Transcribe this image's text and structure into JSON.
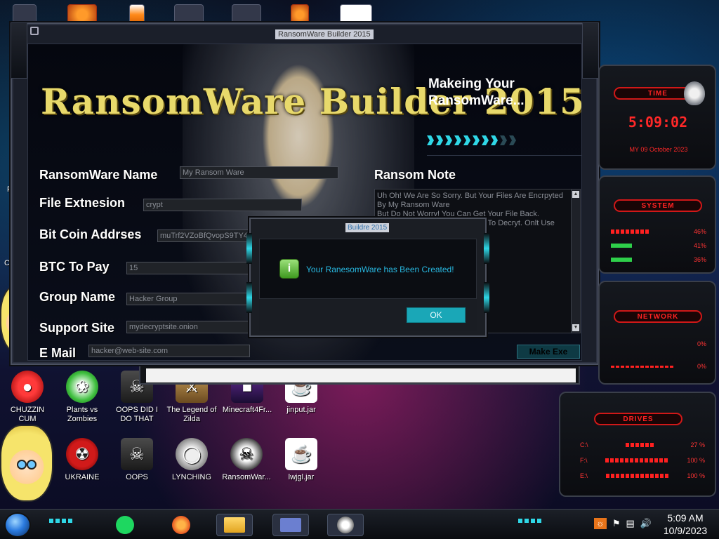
{
  "desktop": {
    "icons": [
      {
        "label": "CHUZZIN\nCUM",
        "glyph": "●",
        "style": "red-blob"
      },
      {
        "label": "Plants vs\nZombies",
        "glyph": "❀",
        "style": "plant"
      },
      {
        "label": "OOPS DID I\nDO THAT",
        "glyph": "☠",
        "style": "oops"
      },
      {
        "label": "The Legend of\nZilda",
        "glyph": "⚔",
        "style": "legend"
      },
      {
        "label": "Minecraft4Fr...",
        "glyph": "■",
        "style": "mc"
      },
      {
        "label": "jinput.jar",
        "glyph": "☕",
        "style": "java"
      },
      {
        "label": "UKRAINE",
        "glyph": "☢",
        "style": "radiation"
      },
      {
        "label": "OOPS",
        "glyph": "☠",
        "style": "oops"
      },
      {
        "label": "LYNCHING",
        "glyph": "◯",
        "style": "noose"
      },
      {
        "label": "RansomWar...",
        "glyph": "☠",
        "style": "skull"
      },
      {
        "label": "lwjgl.jar",
        "glyph": "☕",
        "style": "java"
      }
    ],
    "left_edge_labels": [
      "Re",
      "Co"
    ]
  },
  "builder": {
    "window_title": "RansomWare Builder 2015",
    "brand": "RansomWare Builder 2015",
    "status": "Makeing Your\nRansomWare...",
    "progress_fraction": 0.72,
    "fields": {
      "name_label": "RansomWare Name",
      "name_value": "My Ransom Ware",
      "ext_label": "File Extnesion",
      "ext_value": "crypt",
      "btc_addr_label": "Bit Coin Addrses",
      "btc_addr_value": "muTrf2VZoBfQvopS9TY4FbjU4c9Y2r2f3",
      "btc_pay_label": "BTC To Pay",
      "btc_pay_value": "15",
      "group_label": "Group Name",
      "group_value": "Hacker Group",
      "support_label": "Support Site",
      "support_value": "mydecryptsite.onion",
      "email_label": "E Mail",
      "email_value": "hacker@web-site.com"
    },
    "note_label": "Ransom Note",
    "note_text": "Uh Oh! We Are So Sorry. But Your Files Are Encrpyted By My Ransom Ware\nBut Do Not Worry! You Can Get Your File Back.\nDo NOT Try To Use Other Tools To Decryt. Onlt Use Our Tools.\n\nss:\nY2r2f3\n? Send One Encrypted\nwe will send You it\n\non\nker Group",
    "make_button": "Make Exe"
  },
  "dialog": {
    "title": "Buildre 2015",
    "message": "Your RanesomWare has Been Created!",
    "icon": "info-icon",
    "ok_label": "OK"
  },
  "gadgets": {
    "time_header": "TIME",
    "time_value": "5:09:02",
    "date_value": "MY 09 October 2023",
    "system_header": "SYSTEM",
    "system_rows": [
      "46%",
      "41%",
      "36%"
    ],
    "network_header": "NETWORK",
    "network_rows": [
      "0%",
      "0%"
    ],
    "drives_header": "DRIVES",
    "drives": [
      {
        "name": "C:\\",
        "value": "27 %"
      },
      {
        "name": "F:\\",
        "value": "100 %"
      },
      {
        "name": "E:\\",
        "value": "100 %"
      }
    ]
  },
  "taskbar": {
    "clock_time": "5:09 AM",
    "clock_date": "10/9/2023",
    "apps": [
      "spotify-icon",
      "firefox-icon",
      "file-explorer-icon",
      "window-icon",
      "ransomware-icon"
    ],
    "tray": [
      "bulb-icon",
      "flag-icon",
      "volume-icon"
    ]
  },
  "colors": {
    "accent_teal": "#2fd7e6",
    "gadget_red": "#ff2222",
    "brand_gold": "#e8d96b"
  }
}
